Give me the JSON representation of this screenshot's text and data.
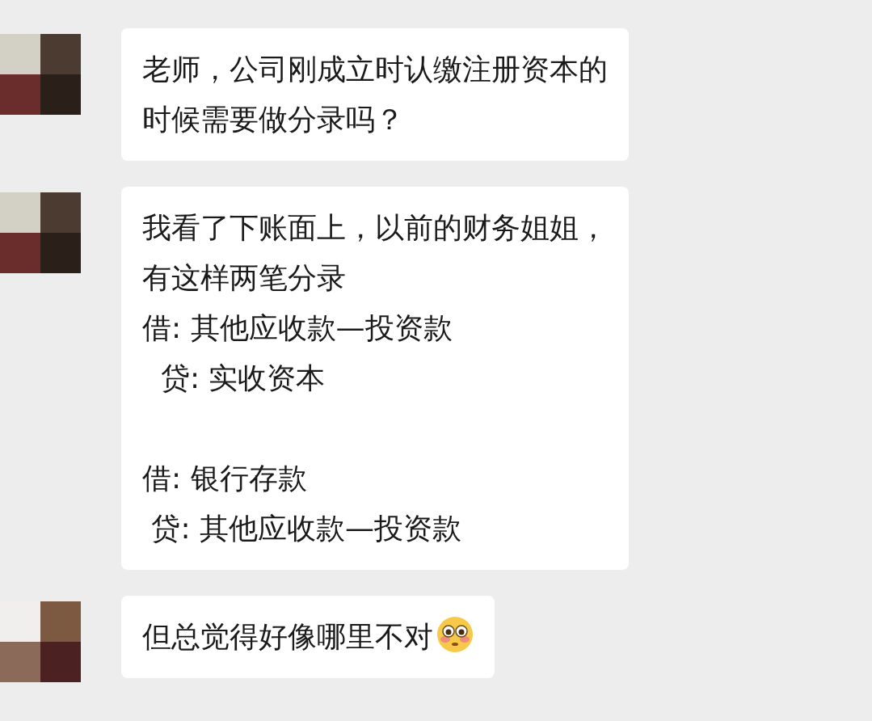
{
  "messages": [
    {
      "avatar": {
        "kind": "picture"
      },
      "paragraphs": [
        [
          "老师，公司刚成立时认缴注册资本的",
          "时候需要做分录吗？"
        ]
      ],
      "emoji": false
    },
    {
      "avatar": {
        "kind": "picture"
      },
      "paragraphs": [
        [
          "我看了下账面上，以前的财务姐姐，",
          "有这样两笔分录",
          "借: 其他应收款—投资款",
          "  贷: 实收资本"
        ],
        [
          "借: 银行存款",
          " 贷: 其他应收款—投资款"
        ]
      ],
      "emoji": false
    },
    {
      "avatar": {
        "kind": "picture"
      },
      "paragraphs": [
        [
          "但总觉得好像哪里不对"
        ]
      ],
      "emoji": true
    }
  ]
}
